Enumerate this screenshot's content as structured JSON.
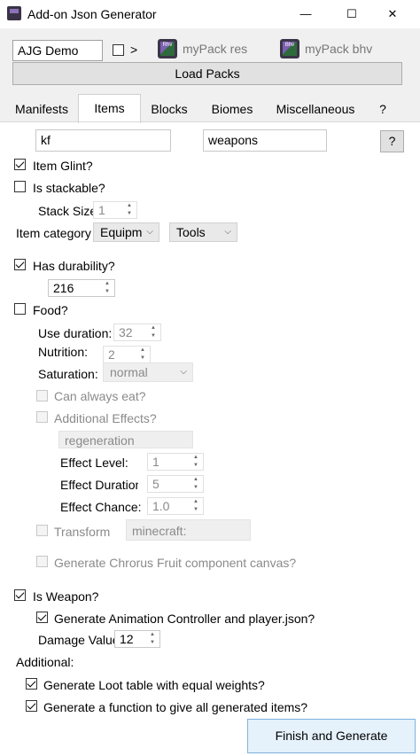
{
  "window": {
    "title": "Add-on Json Generator",
    "minimize": "—",
    "maximize": "☐",
    "close": "✕"
  },
  "header": {
    "project_name": "AJG Demo",
    "arrow": ">",
    "res_pack_name": "myPack res",
    "bhv_pack_name": "myPack bhv",
    "res_icon_text": "Rhv",
    "bhv_icon_text": "Bhv",
    "load_packs_label": "Load Packs"
  },
  "tabs": [
    {
      "label": "Manifests"
    },
    {
      "label": "Items"
    },
    {
      "label": "Blocks"
    },
    {
      "label": "Biomes"
    },
    {
      "label": "Miscellaneous"
    },
    {
      "label": "?"
    }
  ],
  "items": {
    "name_value": "kf",
    "group_value": "weapons",
    "help_label": "?",
    "item_glint": {
      "label": "Item Glint?",
      "checked": true
    },
    "is_stackable": {
      "label": "Is stackable?",
      "checked": false
    },
    "stack_size": {
      "label": "Stack Size",
      "value": "1"
    },
    "item_category": {
      "label": "Item category",
      "category": "Equipm",
      "subcategory": "Tools"
    },
    "has_durability": {
      "label": "Has durability?",
      "checked": true,
      "value": "216"
    },
    "food": {
      "label": "Food?",
      "checked": false,
      "use_duration_label": "Use duration:",
      "use_duration_value": "32",
      "nutrition_label": "Nutrition:",
      "nutrition_value": "2",
      "saturation_label": "Saturation:",
      "saturation_value": "normal",
      "can_always_eat_label": "Can always eat?",
      "additional_effects_label": "Additional Effects?",
      "effect_name": "regeneration",
      "effect_level_label": "Effect Level:",
      "effect_level_value": "1",
      "effect_duration_label": "Effect Duration",
      "effect_duration_value": "5",
      "effect_chance_label": "Effect Chance:",
      "effect_chance_value": "1.0",
      "transform_label": "Transform",
      "transform_value": "minecraft:",
      "chorus_label": "Generate Chrorus Fruit component canvas?"
    },
    "is_weapon": {
      "label": "Is Weapon?",
      "checked": true
    },
    "gen_anim": {
      "label": "Generate Animation Controller and player.json?",
      "checked": true
    },
    "damage": {
      "label": "Damage Value",
      "value": "12"
    },
    "additional_label": "Additional:",
    "loot_table": {
      "label": "Generate Loot table with equal weights?",
      "checked": true
    },
    "give_function": {
      "label": "Generate a function to give all generated items?",
      "checked": true
    },
    "finish_label": "Finish and Generate"
  },
  "colors": {
    "accent_border": "#7fb2dd",
    "accent_fill": "#e5f1fb",
    "panel_bg": "#f0f0f0"
  }
}
